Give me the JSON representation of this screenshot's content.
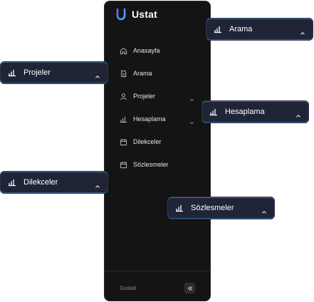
{
  "brand": {
    "name": "Ustat"
  },
  "sidebar": {
    "items": [
      {
        "label": "Anasayfa",
        "icon": "home-icon"
      },
      {
        "label": "Arama",
        "icon": "document-icon"
      },
      {
        "label": "Projeler",
        "icon": "user-icon",
        "chevron": "chevron-down-icon"
      },
      {
        "label": "Hesaplama",
        "icon": "bar-chart-icon",
        "chevron": "chevron-down-icon"
      },
      {
        "label": "Dilekceler",
        "icon": "calendar-icon"
      },
      {
        "label": "Sözlesmeler",
        "icon": "calendar-icon"
      }
    ],
    "footer": "©ustat",
    "collapse_icon": "double-chevron-left-icon"
  },
  "floating_chips": [
    {
      "label": "Arama",
      "icon": "bar-chart-icon",
      "chevron": "chevron-up-icon"
    },
    {
      "label": "Projeler",
      "icon": "bar-chart-icon",
      "chevron": "chevron-up-icon"
    },
    {
      "label": "Hesaplama",
      "icon": "bar-chart-icon",
      "chevron": "chevron-up-icon"
    },
    {
      "label": "Dilekceler",
      "icon": "bar-chart-icon",
      "chevron": "chevron-up-icon"
    },
    {
      "label": "Sözlesmeler",
      "icon": "bar-chart-icon",
      "chevron": "chevron-up-icon"
    }
  ],
  "colors": {
    "sidebar_bg": "#141414",
    "chip_bg": "#1f2537",
    "brand_gradient": [
      "#7c5cff",
      "#3fb6ff"
    ]
  }
}
